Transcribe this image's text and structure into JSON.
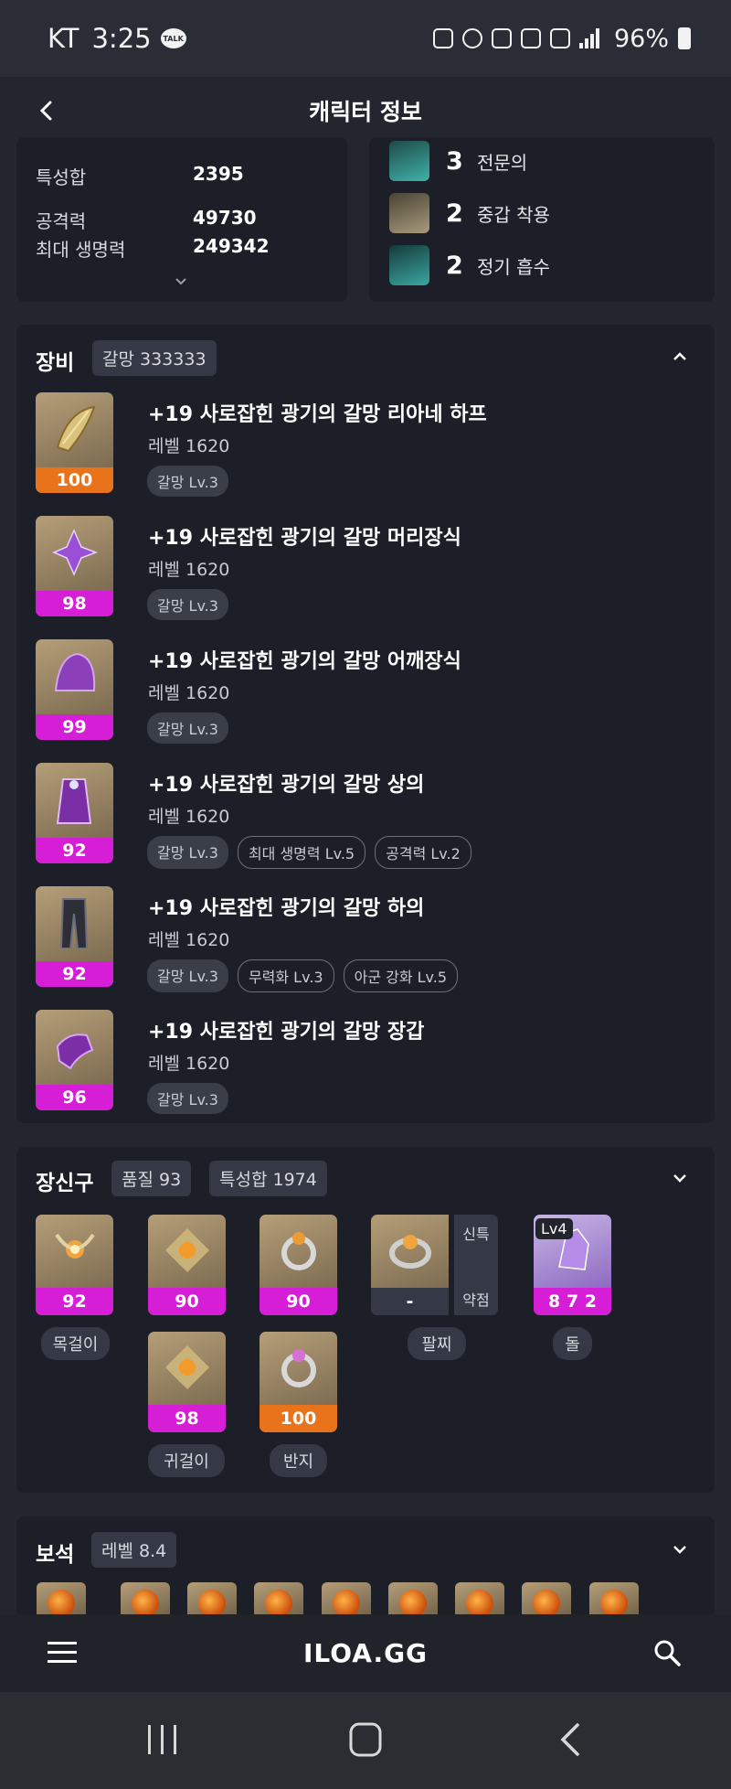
{
  "status_bar": {
    "carrier": "KT",
    "time": "3:25",
    "battery": "96%"
  },
  "app_bar": {
    "title": "캐릭터 정보"
  },
  "stats": {
    "rows": [
      {
        "label": "특성합",
        "value": "2395"
      },
      {
        "label": "공격력",
        "value": "49730"
      },
      {
        "label": "최대 생명력",
        "value": "249342"
      }
    ]
  },
  "engravings": [
    {
      "level": "3",
      "name": "전문의",
      "icon": "engraving-icon-teal",
      "color": "#3fb3a8"
    },
    {
      "level": "2",
      "name": "중갑 착용",
      "icon": "engraving-icon-armor",
      "color": "#a89a7c"
    },
    {
      "level": "2",
      "name": "정기 흡수",
      "icon": "engraving-icon-teal",
      "color": "#3aa7a0"
    }
  ],
  "equipment": {
    "title": "장비",
    "badge": "갈망 333333",
    "items": [
      {
        "name": "+19 사로잡힌 광기의 갈망 리아네 하프",
        "level": "레벨 1620",
        "quality": "100",
        "quality_color": "#e8731a",
        "tags": [
          "갈망 Lv.3"
        ],
        "outline_tags": []
      },
      {
        "name": "+19 사로잡힌 광기의 갈망 머리장식",
        "level": "레벨 1620",
        "quality": "98",
        "quality_color": "#d61ed6",
        "tags": [
          "갈망 Lv.3"
        ],
        "outline_tags": []
      },
      {
        "name": "+19 사로잡힌 광기의 갈망 어깨장식",
        "level": "레벨 1620",
        "quality": "99",
        "quality_color": "#d61ed6",
        "tags": [
          "갈망 Lv.3"
        ],
        "outline_tags": []
      },
      {
        "name": "+19 사로잡힌 광기의 갈망 상의",
        "level": "레벨 1620",
        "quality": "92",
        "quality_color": "#d61ed6",
        "tags": [
          "갈망 Lv.3"
        ],
        "outline_tags": [
          "최대 생명력 Lv.5",
          "공격력 Lv.2"
        ]
      },
      {
        "name": "+19 사로잡힌 광기의 갈망 하의",
        "level": "레벨 1620",
        "quality": "92",
        "quality_color": "#d61ed6",
        "tags": [
          "갈망 Lv.3"
        ],
        "outline_tags": [
          "무력화 Lv.3",
          "아군 강화 Lv.5"
        ]
      },
      {
        "name": "+19 사로잡힌 광기의 갈망 장갑",
        "level": "레벨 1620",
        "quality": "96",
        "quality_color": "#d61ed6",
        "tags": [
          "갈망 Lv.3"
        ],
        "outline_tags": []
      }
    ]
  },
  "accessories": {
    "title": "장신구",
    "badge_quality": "품질 93",
    "badge_stats": "특성합 1974",
    "necklace": {
      "quality": "92",
      "label": "목걸이"
    },
    "earrings": [
      {
        "quality": "90"
      },
      {
        "quality": "98"
      }
    ],
    "earring_label": "귀걸이",
    "rings": [
      {
        "quality": "90"
      },
      {
        "quality": "100"
      }
    ],
    "ring_label": "반지",
    "bracelet": {
      "quality": "-",
      "label": "팔찌",
      "side_top": "신특",
      "side_bottom": "약점"
    },
    "stone": {
      "badge": "Lv4",
      "quality": "8 7 2",
      "label": "돌"
    }
  },
  "gems": {
    "title": "보석",
    "badge": "레벨 8.4"
  },
  "site_bar": {
    "logo": "ILOA.GG"
  },
  "colors": {
    "purple_quality": "#d61ed6",
    "orange_quality": "#e8731a"
  }
}
